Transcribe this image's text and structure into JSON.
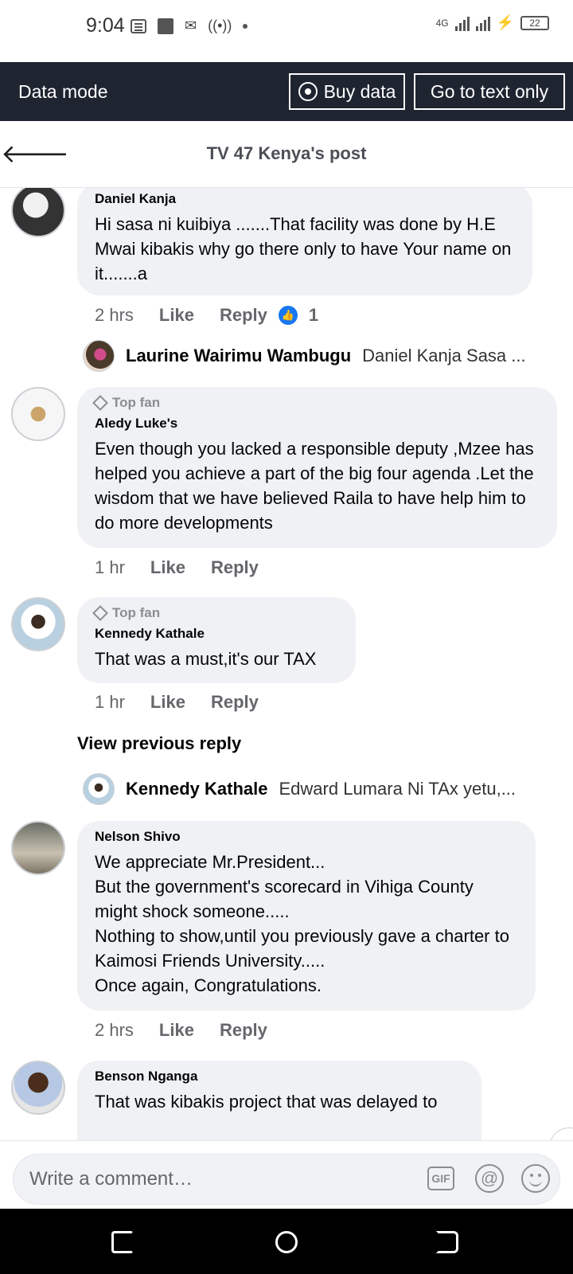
{
  "status_bar": {
    "time": "9:04",
    "network": "4G",
    "battery": "22"
  },
  "data_bar": {
    "title": "Data mode",
    "buy_data_label": "Buy data",
    "text_only_label": "Go to text only"
  },
  "header": {
    "title": "TV 47 Kenya's post"
  },
  "comments": [
    {
      "author": "Daniel Kanja",
      "text": "Hi sasa ni kuibiya .......That facility was done by H.E Mwai kibakis why go there only to have Your name on it.......a",
      "time": "2 hrs",
      "like": "Like",
      "reply": "Reply",
      "likes": "1",
      "reply_preview": {
        "name": "Laurine Wairimu Wambugu",
        "text": "Daniel Kanja Sasa ..."
      }
    },
    {
      "badge": "Top fan",
      "author": "Aledy Luke's",
      "text": "Even though you lacked a responsible deputy ,Mzee has helped you achieve a part of the big four agenda .Let the wisdom that we have believed Raila to have help him to do more developments",
      "time": "1 hr",
      "like": "Like",
      "reply": "Reply"
    },
    {
      "badge": "Top fan",
      "author": "Kennedy Kathale",
      "text": "That was a must,it's our TAX",
      "time": "1 hr",
      "like": "Like",
      "reply": "Reply",
      "view_previous": "View previous reply",
      "reply_preview": {
        "name": "Kennedy Kathale",
        "text": "Edward Lumara Ni TAx yetu,..."
      }
    },
    {
      "author": "Nelson Shivo",
      "text": "We appreciate Mr.President...\nBut the government's scorecard in Vihiga County might shock someone.....\nNothing to show,until you previously gave a charter to Kaimosi Friends University.....\nOnce again, Congratulations.",
      "time": "2 hrs",
      "like": "Like",
      "reply": "Reply"
    },
    {
      "author": "Benson Nganga",
      "text": "That was kibakis project that was delayed to"
    }
  ],
  "composer": {
    "placeholder": "Write a comment…",
    "gif_label": "GIF",
    "at_label": "@"
  },
  "icons": {
    "back": "arrow-left-icon",
    "like_badge": "thumbs-up-icon",
    "top_fan": "diamond-icon",
    "gif": "gif-icon",
    "mention": "at-icon",
    "emoji": "smiley-icon"
  },
  "colors": {
    "data_bar_bg": "#1e2430",
    "bubble_bg": "#eff1f4",
    "like_blue": "#1877f2",
    "secondary_text": "#65676b"
  }
}
